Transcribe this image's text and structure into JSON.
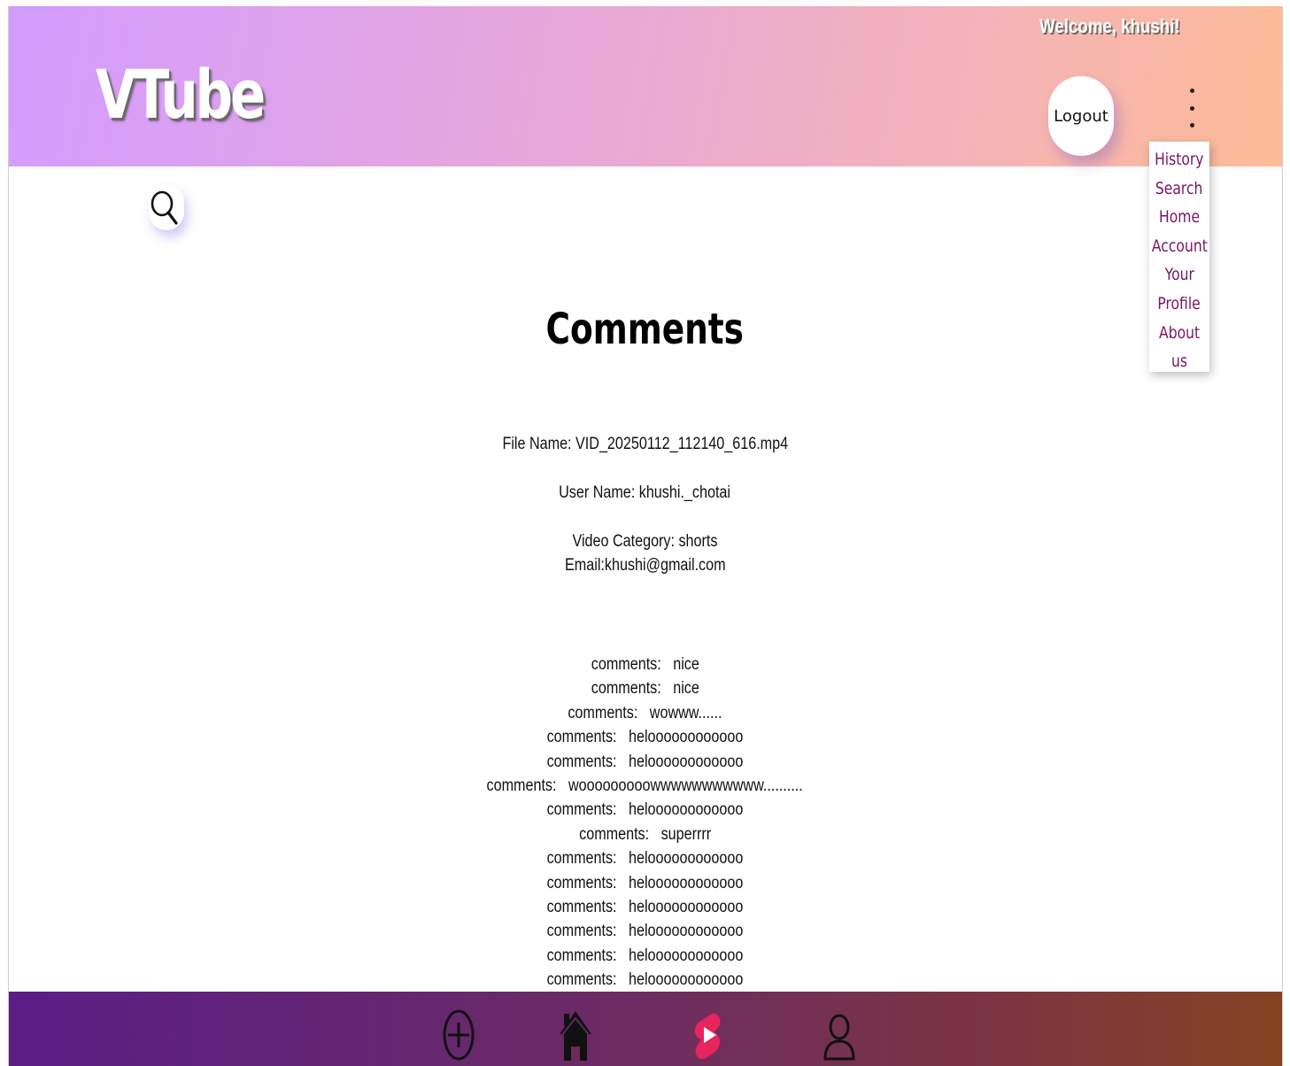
{
  "header": {
    "logo": "VTube",
    "welcome": "Welcome, khushi!",
    "logout_label": "Logout"
  },
  "menu": {
    "items": [
      "History",
      "Search",
      "Home",
      "Account",
      "Your",
      "Profile",
      "About",
      "us"
    ]
  },
  "page": {
    "title": "Comments",
    "file_name": "File Name: VID_20250112_112140_616.mp4",
    "user_name": "User Name: khushi._chotai",
    "video_category": "Video Category: shorts",
    "email": "Email:khushi@gmail.com"
  },
  "comments": [
    "comments:   nice",
    "comments:   nice",
    "comments:   wowww......",
    "comments:   heloooooooooooo",
    "comments:   heloooooooooooo",
    "comments:   wooooooooowwwwwwwwwww..........",
    "comments:   heloooooooooooo",
    "comments:   superrrr",
    "comments:   heloooooooooooo",
    "comments:   heloooooooooooo",
    "comments:   heloooooooooooo",
    "comments:   heloooooooooooo",
    "comments:   heloooooooooooo",
    "comments:   heloooooooooooo"
  ],
  "icons": {
    "search": "search-icon",
    "kebab": "kebab-menu-icon",
    "add": "plus-circle-icon",
    "home": "home-icon",
    "shorts": "shorts-icon",
    "user": "user-icon"
  },
  "colors": {
    "menu_text": "#7a1462",
    "shorts_accent": "#e8245c"
  }
}
